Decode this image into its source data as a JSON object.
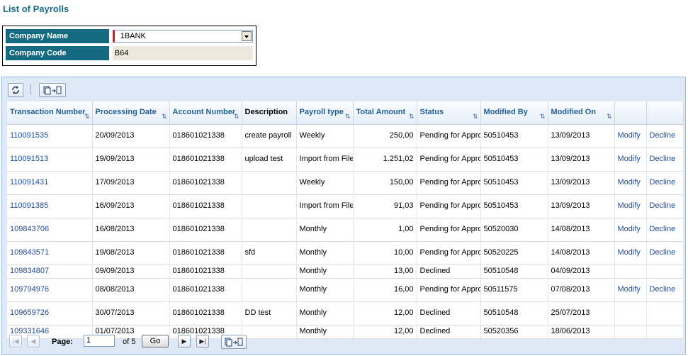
{
  "page": {
    "title": "List of Payrolls"
  },
  "company": {
    "name_label": "Company Name",
    "name_value": "1BANK",
    "code_label": "Company Code",
    "code_value": "B64"
  },
  "toolbar": {
    "refresh_icon": "refresh-icon",
    "export_icon": "export-icon"
  },
  "columns": [
    {
      "label": "Transaction Number",
      "sortable": true
    },
    {
      "label": "Processing Date",
      "sortable": true
    },
    {
      "label": "Account Number",
      "sortable": true
    },
    {
      "label": "Description",
      "sortable": false
    },
    {
      "label": "Payroll type",
      "sortable": true
    },
    {
      "label": "Total Amount",
      "sortable": true
    },
    {
      "label": "Status",
      "sortable": true
    },
    {
      "label": "Modified By",
      "sortable": true
    },
    {
      "label": "Modified On",
      "sortable": true
    },
    {
      "label": "",
      "sortable": false
    },
    {
      "label": "",
      "sortable": false
    }
  ],
  "rows": [
    {
      "txn": "110091535",
      "date": "20/09/2013",
      "account": "018601021338",
      "desc": "create payroll",
      "type": "Weekly",
      "amount": "250,00",
      "status": "Pending for Approval",
      "by": "50510453",
      "on": "13/09/2013",
      "modify": "Modify",
      "decline": "Decline"
    },
    {
      "txn": "110091513",
      "date": "19/09/2013",
      "account": "018601021338",
      "desc": "upload test",
      "type": "Import from File",
      "amount": "1.251,02",
      "status": "Pending for Approval",
      "by": "50510453",
      "on": "13/09/2013",
      "modify": "Modify",
      "decline": "Decline"
    },
    {
      "txn": "110091431",
      "date": "17/09/2013",
      "account": "018601021338",
      "desc": "",
      "type": "Weekly",
      "amount": "150,00",
      "status": "Pending for Approval",
      "by": "50510453",
      "on": "13/09/2013",
      "modify": "Modify",
      "decline": "Decline"
    },
    {
      "txn": "110091385",
      "date": "16/09/2013",
      "account": "018601021338",
      "desc": "",
      "type": "Import from File",
      "amount": "91,03",
      "status": "Pending for Approval",
      "by": "50510453",
      "on": "13/09/2013",
      "modify": "Modify",
      "decline": "Decline"
    },
    {
      "txn": "109843706",
      "date": "16/08/2013",
      "account": "018601021338",
      "desc": "",
      "type": "Monthly",
      "amount": "1,00",
      "status": "Pending for Approval",
      "by": "50520030",
      "on": "14/08/2013",
      "modify": "Modify",
      "decline": "Decline"
    },
    {
      "txn": "109843571",
      "date": "19/08/2013",
      "account": "018601021338",
      "desc": "sfd",
      "type": "Monthly",
      "amount": "10,00",
      "status": "Pending for Approval",
      "by": "50520225",
      "on": "14/08/2013",
      "modify": "Modify",
      "decline": "Decline"
    },
    {
      "txn": "109834807",
      "date": "09/09/2013",
      "account": "018601021338",
      "desc": "",
      "type": "Monthly",
      "amount": "13,00",
      "status": "Declined",
      "by": "50510548",
      "on": "04/09/2013",
      "modify": "",
      "decline": ""
    },
    {
      "txn": "109794976",
      "date": "08/08/2013",
      "account": "018601021338",
      "desc": "",
      "type": "Monthly",
      "amount": "16,00",
      "status": "Pending for Approval",
      "by": "50511575",
      "on": "07/08/2013",
      "modify": "Modify",
      "decline": "Decline"
    },
    {
      "txn": "109659726",
      "date": "30/07/2013",
      "account": "018601021338",
      "desc": "DD test",
      "type": "Monthly",
      "amount": "12,00",
      "status": "Declined",
      "by": "50510548",
      "on": "25/07/2013",
      "modify": "",
      "decline": ""
    },
    {
      "txn": "109331646",
      "date": "01/07/2013",
      "account": "018601021338",
      "desc": "",
      "type": "Monthly",
      "amount": "12,00",
      "status": "Declined",
      "by": "50520356",
      "on": "18/06/2013",
      "modify": "",
      "decline": ""
    }
  ],
  "pager": {
    "page_label": "Page:",
    "page_value": "1",
    "of_label": "of 5",
    "go_label": "Go"
  }
}
